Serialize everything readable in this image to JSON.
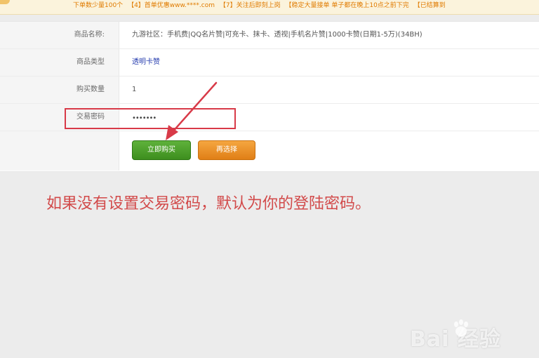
{
  "notice_bar": {
    "items": [
      "下单数少量100个",
      "【4】首单优惠www.****.com",
      "【7】关注后即刻上岗",
      "【稳定大量接单 单子都在晚上10点之前下完",
      "【已结算到"
    ]
  },
  "order_form": {
    "product_name_label": "商品名称:",
    "product_name_value": "九游社区：手机费|QQ名片赞|可充卡、抹卡、透视|手机名片赞|1000卡赞(日期1-5万)(34BH)",
    "product_type_label": "商品类型",
    "product_type_value": "透明卡赞",
    "quantity_label": "购买数量",
    "quantity_value": "1",
    "trade_password_label": "交易密码",
    "trade_password_value": "•••••••",
    "buy_now_button": "立即购买",
    "reselect_button": "再选择"
  },
  "annotation": {
    "note_text": "如果没有设置交易密码，默认为你的登陆密码。"
  },
  "watermark": {
    "text": "Bai 经验"
  },
  "colors": {
    "highlight_red": "#d83a48",
    "note_red": "#d24a4a",
    "buy_green": "#4fa42c",
    "reselect_orange": "#ea9226",
    "link_blue": "#2a40b0"
  }
}
